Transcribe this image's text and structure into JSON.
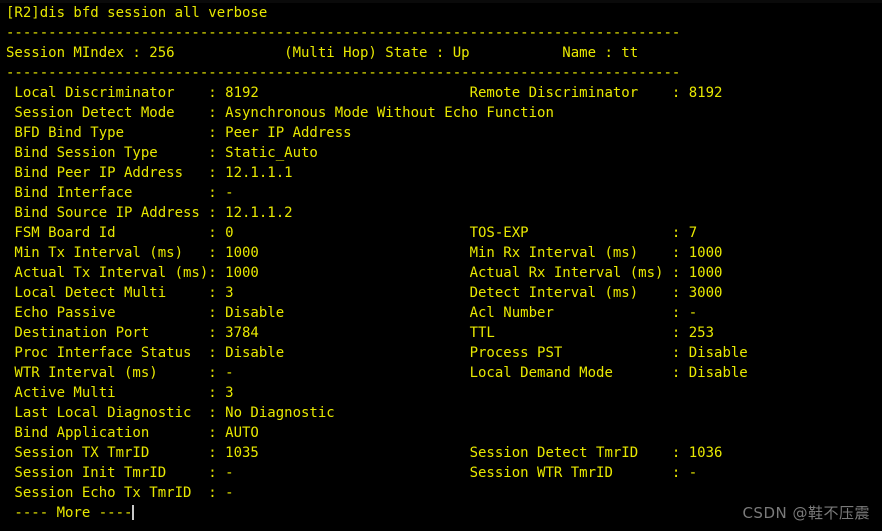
{
  "terminal": {
    "colors": {
      "background": "#000000",
      "foreground": "#e8e800",
      "cursor": "#c8c8c8",
      "watermark": "#7a7a7a"
    },
    "prompt_line": "[R2]dis bfd session all verbose",
    "separator": "--------------------------------------------------------------------------------",
    "summary": {
      "mindex_label": "Session MIndex",
      "mindex_value": "256",
      "hop_mode": "(Multi Hop)",
      "state_label": "State",
      "state_value": "Up",
      "name_label": "Name",
      "name_value": "tt"
    },
    "fields": [
      {
        "left_label": "Local Discriminator",
        "left_value": "8192",
        "right_label": "Remote Discriminator",
        "right_value": "8192"
      },
      {
        "left_label": "Session Detect Mode",
        "left_value": "Asynchronous Mode Without Echo Function",
        "right_label": "",
        "right_value": ""
      },
      {
        "left_label": "BFD Bind Type",
        "left_value": "Peer IP Address",
        "right_label": "",
        "right_value": ""
      },
      {
        "left_label": "Bind Session Type",
        "left_value": "Static_Auto",
        "right_label": "",
        "right_value": ""
      },
      {
        "left_label": "Bind Peer IP Address",
        "left_value": "12.1.1.1",
        "right_label": "",
        "right_value": ""
      },
      {
        "left_label": "Bind Interface",
        "left_value": "-",
        "right_label": "",
        "right_value": ""
      },
      {
        "left_label": "Bind Source IP Address",
        "left_value": "12.1.1.2",
        "right_label": "",
        "right_value": ""
      },
      {
        "left_label": "FSM Board Id",
        "left_value": "0",
        "right_label": "TOS-EXP",
        "right_value": "7"
      },
      {
        "left_label": "Min Tx Interval (ms)",
        "left_value": "1000",
        "right_label": "Min Rx Interval (ms)",
        "right_value": "1000"
      },
      {
        "left_label": "Actual Tx Interval (ms)",
        "left_value": "1000",
        "right_label": "Actual Rx Interval (ms)",
        "right_value": "1000"
      },
      {
        "left_label": "Local Detect Multi",
        "left_value": "3",
        "right_label": "Detect Interval (ms)",
        "right_value": "3000"
      },
      {
        "left_label": "Echo Passive",
        "left_value": "Disable",
        "right_label": "Acl Number",
        "right_value": "-"
      },
      {
        "left_label": "Destination Port",
        "left_value": "3784",
        "right_label": "TTL",
        "right_value": "253"
      },
      {
        "left_label": "Proc Interface Status",
        "left_value": "Disable",
        "right_label": "Process PST",
        "right_value": "Disable"
      },
      {
        "left_label": "WTR Interval (ms)",
        "left_value": "-",
        "right_label": "Local Demand Mode",
        "right_value": "Disable"
      },
      {
        "left_label": "Active Multi",
        "left_value": "3",
        "right_label": "",
        "right_value": ""
      },
      {
        "left_label": "Last Local Diagnostic",
        "left_value": "No Diagnostic",
        "right_label": "",
        "right_value": ""
      },
      {
        "left_label": "Bind Application",
        "left_value": "AUTO",
        "right_label": "",
        "right_value": ""
      },
      {
        "left_label": "Session TX TmrID",
        "left_value": "1035",
        "right_label": "Session Detect TmrID",
        "right_value": "1036"
      },
      {
        "left_label": "Session Init TmrID",
        "left_value": "-",
        "right_label": "Session WTR TmrID",
        "right_value": "-"
      },
      {
        "left_label": "Session Echo Tx TmrID",
        "left_value": "-",
        "right_label": "",
        "right_value": ""
      }
    ],
    "more_prompt": "---- More ----"
  },
  "watermark": {
    "text": "CSDN @鞋不压震"
  }
}
